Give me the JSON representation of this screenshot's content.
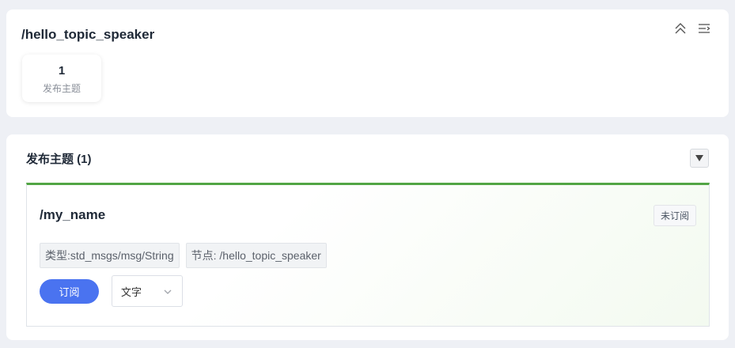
{
  "node": {
    "title": "/hello_topic_speaker",
    "stats": {
      "count": "1",
      "label": "发布主题"
    }
  },
  "icons": {
    "collapse": "chevrons-up-icon",
    "menu": "menu-lines-icon",
    "toggle": "triangle-down-icon",
    "dropdown": "chevron-down-icon"
  },
  "section": {
    "title": "发布主题 (1)"
  },
  "topic": {
    "name": "/my_name",
    "status": "未订阅",
    "type_tag": "类型:std_msgs/msg/String",
    "node_tag": "节点: /hello_topic_speaker",
    "subscribe_label": "订阅",
    "mode_value": "文字"
  },
  "colors": {
    "accent_green": "#52a544",
    "button_blue": "#4a73f0",
    "page_bg": "#eef0f5"
  }
}
